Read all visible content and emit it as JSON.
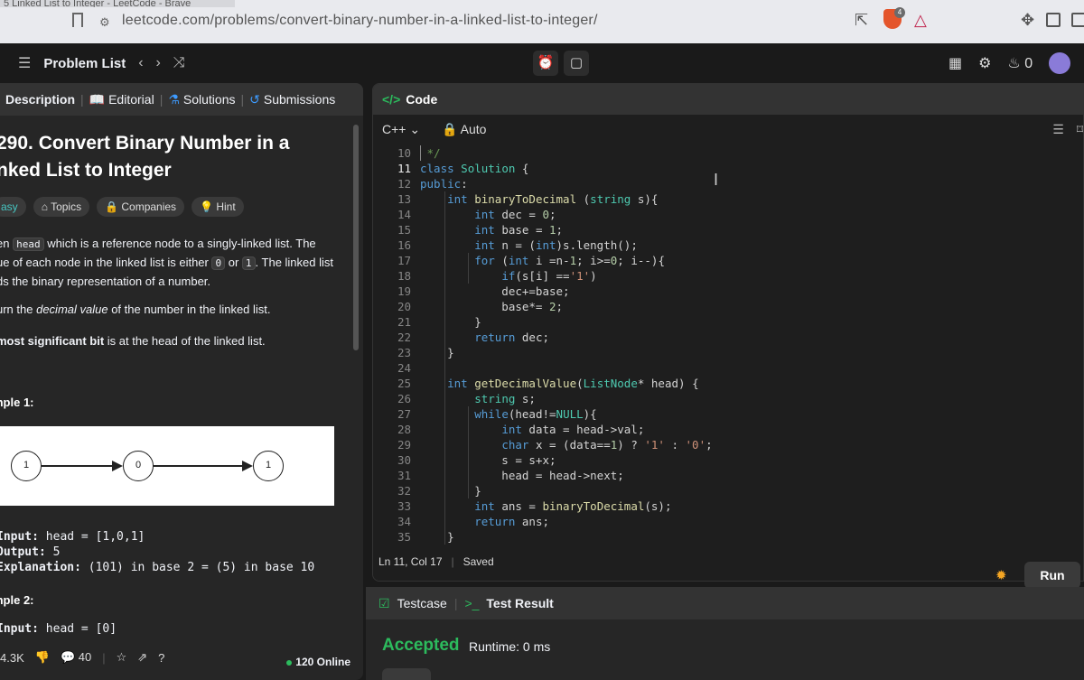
{
  "browser": {
    "tab_title": "5 Linked List to Integer - LeetCode - Brave",
    "url": "leetcode.com/problems/convert-binary-number-in-a-linked-list-to-integer/",
    "shield_count": "4"
  },
  "nav": {
    "problem_list": "Problem List",
    "streak": "0"
  },
  "left": {
    "tabs": [
      "Description",
      "Editorial",
      "Solutions",
      "Submissions"
    ],
    "title_line1": "290. Convert Binary Number in a",
    "title_line2": "nked List to Integer",
    "chips": [
      "asy",
      "Topics",
      "Companies",
      "Hint"
    ],
    "p1_a": "en ",
    "p1_code": "head",
    "p1_b": " which is a reference node to a singly-linked list. The",
    "p2_a": "ue of each node in the linked list is either ",
    "p2_code1": "0",
    "p2_mid": " or ",
    "p2_code2": "1",
    "p2_b": ". The linked list",
    "p3": "ds the binary representation of a number.",
    "p4_a": "urn the ",
    "p4_em": "decimal value",
    "p4_b": " of the number in the linked list.",
    "p5_bold": "most significant bit",
    "p5_b": " is at the head of the linked list.",
    "example1": "mple 1:",
    "nodes": [
      "1",
      "0",
      "1"
    ],
    "ex_input_label": "Input:",
    "ex_input_val": " head = [1,0,1]",
    "ex_output_label": "Output:",
    "ex_output_val": " 5",
    "ex_expl_label": "Explanation:",
    "ex_expl_val": " (101) in base 2 = (5) in base 10",
    "example2": "mple 2:",
    "ex2_input_label": "Input:",
    "ex2_input_val": " head = [0]",
    "likes": "4.3K",
    "comments": "40",
    "online": "120 Online"
  },
  "code": {
    "header": "Code",
    "language": "C++",
    "auto": "Auto",
    "status_pos": "Ln 11, Col 17",
    "status_saved": "Saved",
    "lines": [
      {
        "n": "10",
        "t": " */"
      },
      {
        "n": "11",
        "t": "class Solution {"
      },
      {
        "n": "12",
        "t": "public:"
      },
      {
        "n": "13",
        "t": "    int binaryToDecimal (string s){"
      },
      {
        "n": "14",
        "t": "        int dec = 0;"
      },
      {
        "n": "15",
        "t": "        int base = 1;"
      },
      {
        "n": "16",
        "t": "        int n = (int)s.length();"
      },
      {
        "n": "17",
        "t": "        for (int i =n-1; i>=0; i--){"
      },
      {
        "n": "18",
        "t": "            if(s[i] =='1')"
      },
      {
        "n": "19",
        "t": "            dec+=base;"
      },
      {
        "n": "20",
        "t": "            base*= 2;"
      },
      {
        "n": "21",
        "t": "        }"
      },
      {
        "n": "22",
        "t": "        return dec;"
      },
      {
        "n": "23",
        "t": "    }"
      },
      {
        "n": "24",
        "t": ""
      },
      {
        "n": "25",
        "t": "    int getDecimalValue(ListNode* head) {"
      },
      {
        "n": "26",
        "t": "        string s;"
      },
      {
        "n": "27",
        "t": "        while(head!=NULL){"
      },
      {
        "n": "28",
        "t": "            int data = head->val;"
      },
      {
        "n": "29",
        "t": "            char x = (data==1) ? '1' : '0';"
      },
      {
        "n": "30",
        "t": "            s = s+x;"
      },
      {
        "n": "31",
        "t": "            head = head->next;"
      },
      {
        "n": "32",
        "t": "        }"
      },
      {
        "n": "33",
        "t": "        int ans = binaryToDecimal(s);"
      },
      {
        "n": "34",
        "t": "        return ans;"
      },
      {
        "n": "35",
        "t": "    }"
      }
    ]
  },
  "run": {
    "label": "Run"
  },
  "result": {
    "tab_testcase": "Testcase",
    "tab_result": "Test Result",
    "status": "Accepted",
    "runtime": "Runtime: 0 ms"
  }
}
